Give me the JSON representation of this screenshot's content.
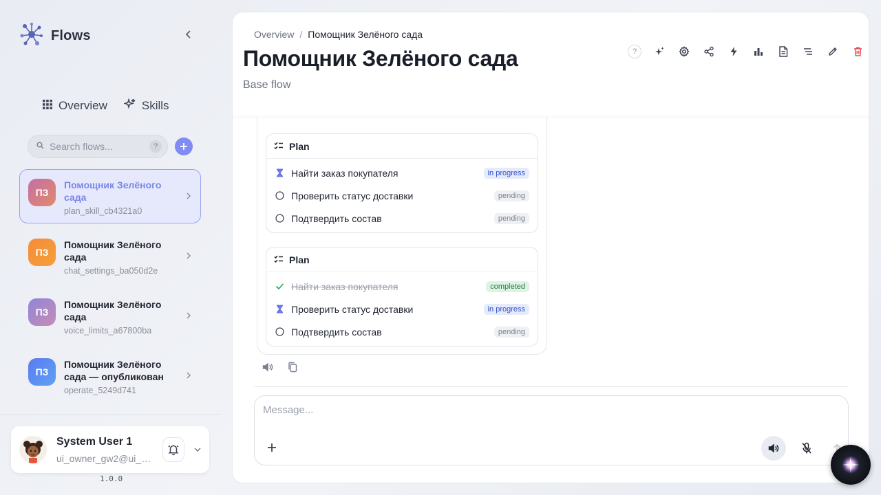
{
  "app": {
    "title": "Flows",
    "version": "1.0.0"
  },
  "nav": {
    "overview_label": "Overview",
    "skills_label": "Skills"
  },
  "search": {
    "placeholder": "Search flows...",
    "help": "?"
  },
  "flows": [
    {
      "initials": "ПЗ",
      "name": "Помощник Зелёного сада",
      "id": "plan_skill_cb4321a0",
      "active": true
    },
    {
      "initials": "ПЗ",
      "name": "Помощник Зелёного сада",
      "id": "chat_settings_ba050d2e",
      "active": false
    },
    {
      "initials": "ПЗ",
      "name": "Помощник Зелёного сада",
      "id": "voice_limits_a67800ba",
      "active": false
    },
    {
      "initials": "ПЗ",
      "name": "Помощник Зелёного сада — опубликован",
      "id": "operate_5249d741",
      "active": false
    }
  ],
  "user": {
    "name": "System User 1",
    "email": "ui_owner_gw2@ui_e..."
  },
  "breadcrumb": {
    "root": "Overview",
    "separator": "/",
    "current": "Помощник Зелёного сада"
  },
  "page": {
    "title": "Помощник Зелёного сада",
    "subtitle": "Base flow"
  },
  "toolbar": {
    "help": "?",
    "icons": [
      "sparkle-icon",
      "gear-icon",
      "share-icon",
      "bolt-icon",
      "bar-chart-icon",
      "document-icon",
      "outline-icon",
      "pencil-icon",
      "trash-icon"
    ]
  },
  "plans": [
    {
      "title": "Plan",
      "tasks": [
        {
          "text": "Найти заказ покупателя",
          "status": "in progress",
          "state": "progress"
        },
        {
          "text": "Проверить статус доставки",
          "status": "pending",
          "state": "pending"
        },
        {
          "text": "Подтвердить состав",
          "status": "pending",
          "state": "pending"
        }
      ]
    },
    {
      "title": "Plan",
      "tasks": [
        {
          "text": "Найти заказ покупателя",
          "status": "completed",
          "state": "completed"
        },
        {
          "text": "Проверить статус доставки",
          "status": "in progress",
          "state": "progress"
        },
        {
          "text": "Подтвердить состав",
          "status": "pending",
          "state": "pending"
        }
      ]
    }
  ],
  "composer": {
    "placeholder": "Message..."
  },
  "colors": {
    "accent": "#7f8cf3",
    "active_border": "#9aa4f1",
    "danger": "#e5484d",
    "avatar_gradients": [
      "#c36fa6-#e38a6a",
      "#f48c3a-#f5a03a",
      "#8f86d9-#c78cb4",
      "#5a7cf0-#5fa0f2"
    ]
  }
}
